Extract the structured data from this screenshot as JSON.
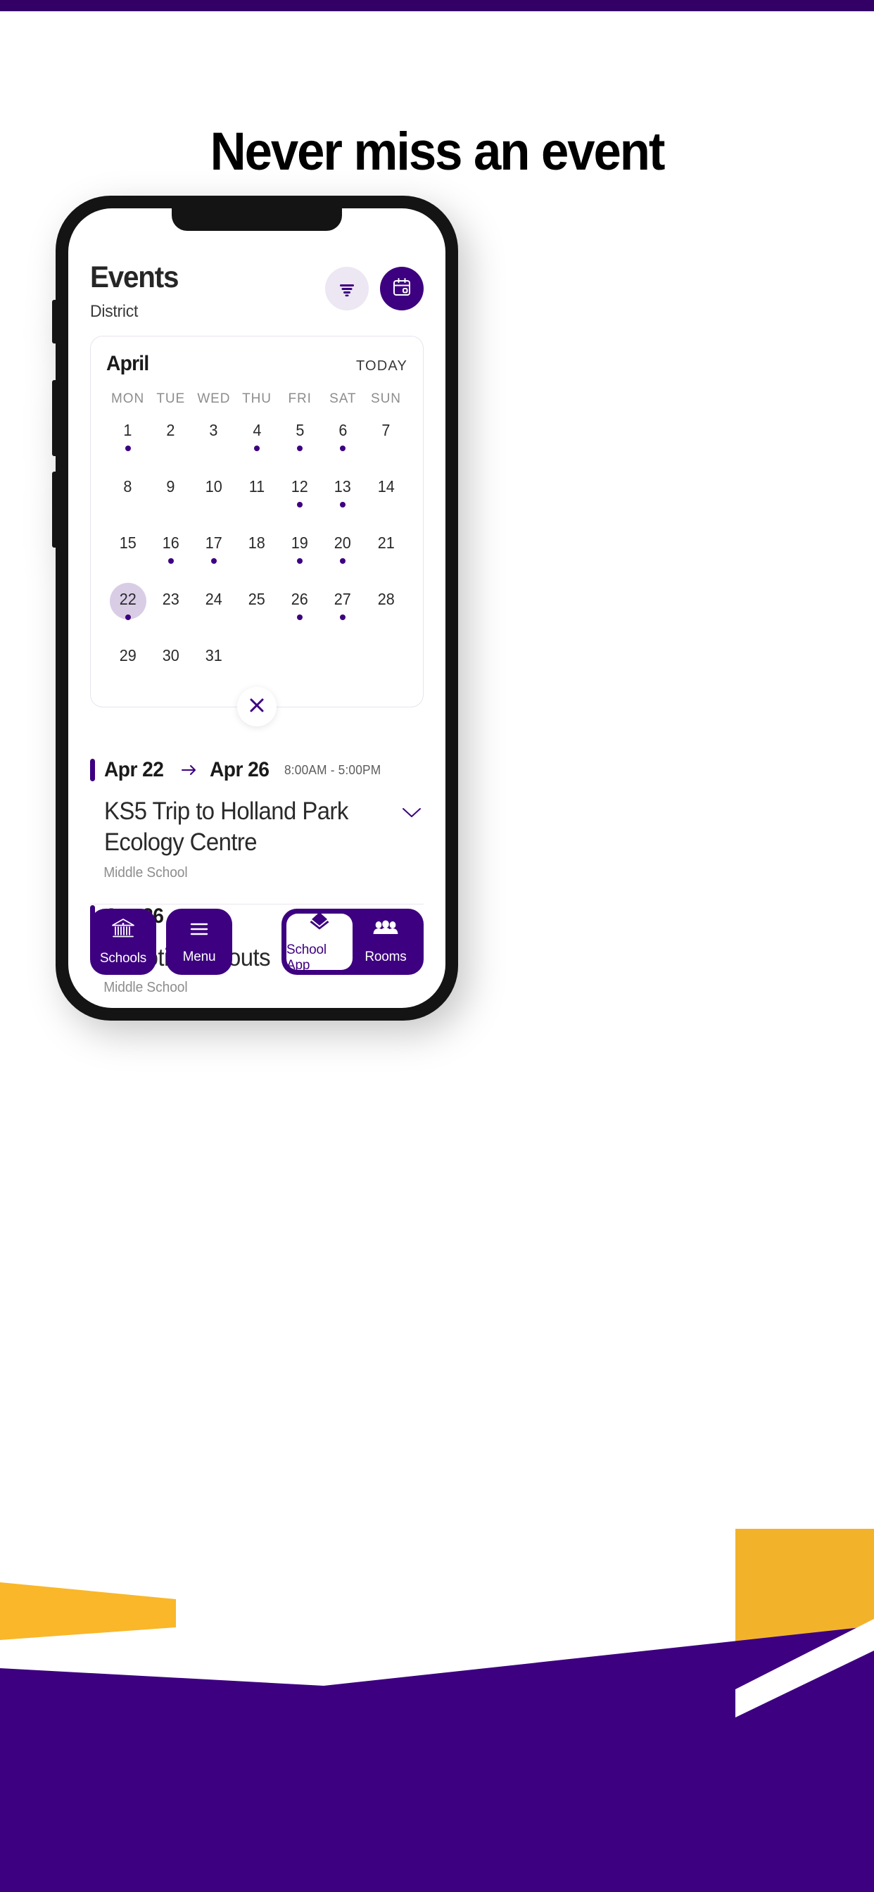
{
  "page": {
    "headline": "Never miss an event",
    "accent_purple": "#3d0080",
    "accent_purple_dark": "#330066",
    "accent_lavender": "#ece7f2",
    "accent_selected": "#d9cde6",
    "accent_yellow": "#f9b729"
  },
  "app": {
    "title": "Events",
    "subtitle": "District",
    "actions": [
      {
        "name": "filter-button",
        "icon": "filter-icon"
      },
      {
        "name": "calendar-button",
        "icon": "calendar-icon"
      }
    ]
  },
  "calendar": {
    "month": "April",
    "today_label": "TODAY",
    "weekdays": [
      "MON",
      "TUE",
      "WED",
      "THU",
      "FRI",
      "SAT",
      "SUN"
    ],
    "close_icon": "close-icon",
    "weeks": [
      [
        {
          "day": "1",
          "dot": true,
          "selected": false
        },
        {
          "day": "2",
          "dot": false,
          "selected": false
        },
        {
          "day": "3",
          "dot": false,
          "selected": false
        },
        {
          "day": "4",
          "dot": true,
          "selected": false
        },
        {
          "day": "5",
          "dot": true,
          "selected": false
        },
        {
          "day": "6",
          "dot": true,
          "selected": false
        },
        {
          "day": "7",
          "dot": false,
          "selected": false
        }
      ],
      [
        {
          "day": "8",
          "dot": false,
          "selected": false
        },
        {
          "day": "9",
          "dot": false,
          "selected": false
        },
        {
          "day": "10",
          "dot": false,
          "selected": false
        },
        {
          "day": "11",
          "dot": false,
          "selected": false
        },
        {
          "day": "12",
          "dot": true,
          "selected": false
        },
        {
          "day": "13",
          "dot": true,
          "selected": false
        },
        {
          "day": "14",
          "dot": false,
          "selected": false
        }
      ],
      [
        {
          "day": "15",
          "dot": false,
          "selected": false
        },
        {
          "day": "16",
          "dot": true,
          "selected": false
        },
        {
          "day": "17",
          "dot": true,
          "selected": false
        },
        {
          "day": "18",
          "dot": false,
          "selected": false
        },
        {
          "day": "19",
          "dot": true,
          "selected": false
        },
        {
          "day": "20",
          "dot": true,
          "selected": false
        },
        {
          "day": "21",
          "dot": false,
          "selected": false
        }
      ],
      [
        {
          "day": "22",
          "dot": true,
          "selected": true
        },
        {
          "day": "23",
          "dot": false,
          "selected": false
        },
        {
          "day": "24",
          "dot": false,
          "selected": false
        },
        {
          "day": "25",
          "dot": false,
          "selected": false
        },
        {
          "day": "26",
          "dot": true,
          "selected": false
        },
        {
          "day": "27",
          "dot": true,
          "selected": false
        },
        {
          "day": "28",
          "dot": false,
          "selected": false
        }
      ],
      [
        {
          "day": "29",
          "dot": false,
          "selected": false
        },
        {
          "day": "30",
          "dot": false,
          "selected": false
        },
        {
          "day": "31",
          "dot": false,
          "selected": false
        },
        {
          "day": "",
          "dot": false,
          "selected": false
        },
        {
          "day": "",
          "dot": false,
          "selected": false
        },
        {
          "day": "",
          "dot": false,
          "selected": false
        },
        {
          "day": "",
          "dot": false,
          "selected": false
        }
      ]
    ]
  },
  "events": [
    {
      "date_start": "Apr 22",
      "date_end": "Apr 26",
      "has_range": true,
      "time": "8:00AM  -  5:00PM",
      "title": "KS5 Trip to Holland Park Ecology Centre",
      "school": "Middle School",
      "expanded": false,
      "chevron": "chevron-down-icon"
    },
    {
      "date_start": "Apr 26",
      "date_end": "",
      "has_range": false,
      "time": "",
      "title": "Robotics Tryouts",
      "school": "Middle School",
      "expanded": true,
      "chevron": "chevron-up-icon"
    }
  ],
  "bottom_nav": {
    "left": [
      {
        "label": "Schools",
        "icon": "school-building-icon"
      },
      {
        "label": "Menu",
        "icon": "hamburger-menu-icon"
      }
    ],
    "group": [
      {
        "label": "School App",
        "icon": "layers-icon",
        "active": true
      },
      {
        "label": "Rooms",
        "icon": "people-icon",
        "active": false
      }
    ]
  }
}
